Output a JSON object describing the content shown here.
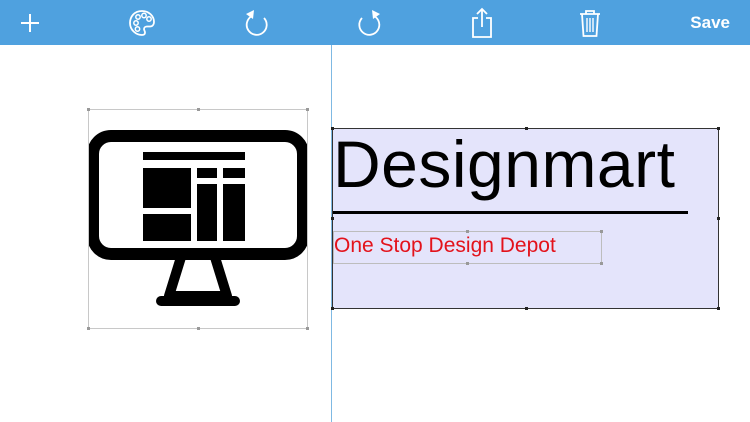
{
  "toolbar": {
    "add_icon": "plus-icon",
    "palette_icon": "palette-icon",
    "undo_icon": "undo-icon",
    "redo_icon": "redo-icon",
    "share_icon": "share-icon",
    "trash_icon": "trash-icon",
    "save_label": "Save"
  },
  "canvas": {
    "logo_icon": "monitor-layout-icon",
    "text_block": {
      "brand_name": "Designmart",
      "tagline": "One Stop Design Depot"
    }
  },
  "colors": {
    "toolbar": "#4fa1df",
    "selection_fill": "#e4e4fb",
    "tagline": "#e3121b",
    "guide_line": "#7fb9e3"
  }
}
